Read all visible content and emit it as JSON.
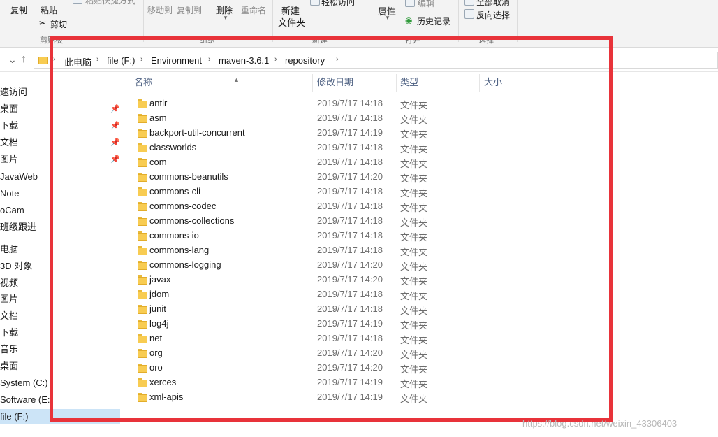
{
  "ribbon": {
    "copy": "复制",
    "paste": "粘贴",
    "paste_shortcut": "粘贴快捷方式",
    "cut": "剪切",
    "move_to": "移动到",
    "copy_to": "复制到",
    "delete": "删除",
    "rename": "重命名",
    "new_folder_line1": "新建",
    "new_folder_line2": "文件夹",
    "easy_access": "轻松访问",
    "properties": "属性",
    "edit": "编辑",
    "history": "历史记录",
    "select_none": "全部取消",
    "invert_selection": "反向选择",
    "group_clipboard": "剪贴板",
    "group_organize": "组织",
    "group_new": "新建",
    "group_open": "打开",
    "group_select": "选择"
  },
  "address": {
    "crumbs": [
      "此电脑",
      "file (F:)",
      "Environment",
      "maven-3.6.1",
      "repository"
    ]
  },
  "sidebar": {
    "items": [
      {
        "label": "速访问",
        "pinned": false
      },
      {
        "label": "桌面",
        "pinned": true
      },
      {
        "label": "下载",
        "pinned": true
      },
      {
        "label": "文档",
        "pinned": true
      },
      {
        "label": "图片",
        "pinned": true
      },
      {
        "label": "JavaWeb",
        "pinned": false
      },
      {
        "label": "Note",
        "pinned": false
      },
      {
        "label": "oCam",
        "pinned": false
      },
      {
        "label": "班级跟进",
        "pinned": false
      },
      {
        "label": "电脑",
        "pinned": false
      },
      {
        "label": "3D 对象",
        "pinned": false
      },
      {
        "label": "视频",
        "pinned": false
      },
      {
        "label": "图片",
        "pinned": false
      },
      {
        "label": "文档",
        "pinned": false
      },
      {
        "label": "下载",
        "pinned": false
      },
      {
        "label": "音乐",
        "pinned": false
      },
      {
        "label": "桌面",
        "pinned": false
      },
      {
        "label": "System (C:)",
        "pinned": false
      },
      {
        "label": "Software (E:)",
        "pinned": false
      },
      {
        "label": "file (F:)",
        "pinned": false,
        "selected": true
      }
    ]
  },
  "columns": {
    "name": "名称",
    "date": "修改日期",
    "type": "类型",
    "size": "大小"
  },
  "files": [
    {
      "name": "antlr",
      "date": "2019/7/17 14:18",
      "type": "文件夹"
    },
    {
      "name": "asm",
      "date": "2019/7/17 14:18",
      "type": "文件夹"
    },
    {
      "name": "backport-util-concurrent",
      "date": "2019/7/17 14:19",
      "type": "文件夹"
    },
    {
      "name": "classworlds",
      "date": "2019/7/17 14:18",
      "type": "文件夹"
    },
    {
      "name": "com",
      "date": "2019/7/17 14:18",
      "type": "文件夹"
    },
    {
      "name": "commons-beanutils",
      "date": "2019/7/17 14:20",
      "type": "文件夹"
    },
    {
      "name": "commons-cli",
      "date": "2019/7/17 14:18",
      "type": "文件夹"
    },
    {
      "name": "commons-codec",
      "date": "2019/7/17 14:18",
      "type": "文件夹"
    },
    {
      "name": "commons-collections",
      "date": "2019/7/17 14:18",
      "type": "文件夹"
    },
    {
      "name": "commons-io",
      "date": "2019/7/17 14:18",
      "type": "文件夹"
    },
    {
      "name": "commons-lang",
      "date": "2019/7/17 14:18",
      "type": "文件夹"
    },
    {
      "name": "commons-logging",
      "date": "2019/7/17 14:20",
      "type": "文件夹"
    },
    {
      "name": "javax",
      "date": "2019/7/17 14:20",
      "type": "文件夹"
    },
    {
      "name": "jdom",
      "date": "2019/7/17 14:18",
      "type": "文件夹"
    },
    {
      "name": "junit",
      "date": "2019/7/17 14:18",
      "type": "文件夹"
    },
    {
      "name": "log4j",
      "date": "2019/7/17 14:19",
      "type": "文件夹"
    },
    {
      "name": "net",
      "date": "2019/7/17 14:18",
      "type": "文件夹"
    },
    {
      "name": "org",
      "date": "2019/7/17 14:20",
      "type": "文件夹"
    },
    {
      "name": "oro",
      "date": "2019/7/17 14:20",
      "type": "文件夹"
    },
    {
      "name": "xerces",
      "date": "2019/7/17 14:19",
      "type": "文件夹"
    },
    {
      "name": "xml-apis",
      "date": "2019/7/17 14:19",
      "type": "文件夹"
    }
  ],
  "watermark": "https://blog.csdn.net/weixin_43306403",
  "colors": {
    "highlight": "#e8333a",
    "folder": "#f8cc52",
    "selection": "#cce4f7"
  }
}
